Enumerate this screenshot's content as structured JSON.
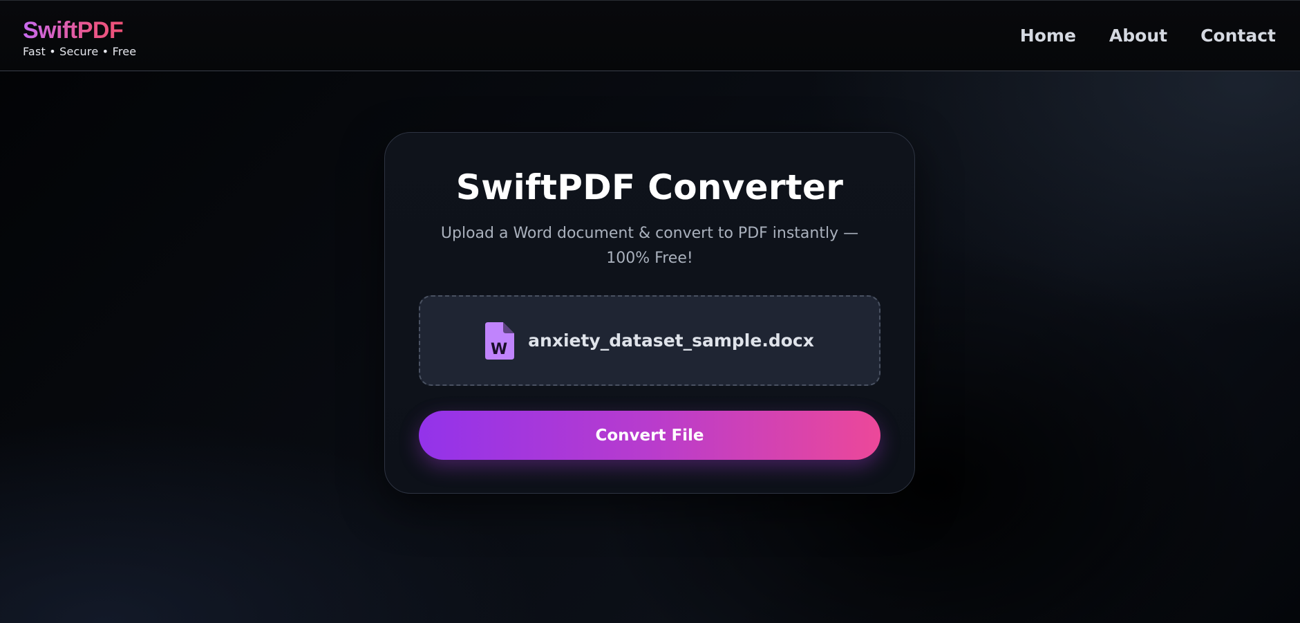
{
  "header": {
    "brand_name": "SwiftPDF",
    "brand_tagline": "Fast • Secure • Free",
    "nav": {
      "home": "Home",
      "about": "About",
      "contact": "Contact"
    }
  },
  "card": {
    "title": "SwiftPDF Converter",
    "subtitle": "Upload a Word document & convert to PDF instantly — 100% Free!",
    "dropzone": {
      "file_icon": "word-file-icon",
      "file_icon_letter": "W",
      "file_name": "anxiety_dataset_sample.docx"
    },
    "convert_button": "Convert File"
  },
  "colors": {
    "accent_start": "#9333ea",
    "accent_end": "#ec4899",
    "file_icon": "#c084fc"
  }
}
